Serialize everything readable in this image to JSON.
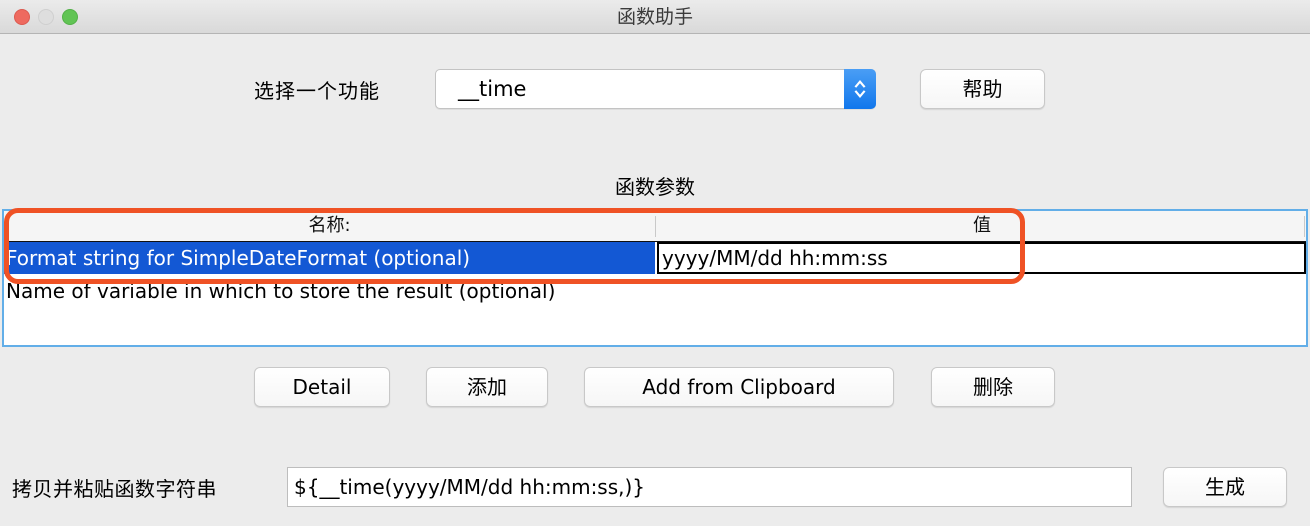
{
  "window": {
    "title": "函数助手",
    "traffic_lights": [
      {
        "name": "close",
        "color": "#ee6a5f"
      },
      {
        "name": "minimize",
        "color": "#dedede"
      },
      {
        "name": "zoom",
        "color": "#61c454"
      }
    ]
  },
  "selector_row": {
    "label": "选择一个功能",
    "combo_value": "__time",
    "combo_stepper_icon": "chevron-up-down-icon",
    "help_label": "帮助"
  },
  "section": {
    "heading": "函数参数"
  },
  "table": {
    "columns": [
      "名称:",
      "值"
    ],
    "rows": [
      {
        "name": "Format string for SimpleDateFormat (optional)",
        "value": "yyyy/MM/dd hh:mm:ss",
        "selected": true,
        "editing": true
      },
      {
        "name": "Name of variable in which to store the result (optional)",
        "value": "",
        "selected": false,
        "editing": false
      }
    ]
  },
  "annotation": {
    "shape": "rounded-rectangle",
    "color": "#ef5225"
  },
  "actions": [
    {
      "label": "Detail"
    },
    {
      "label": "添加"
    },
    {
      "label": "Add from Clipboard"
    },
    {
      "label": "删除"
    }
  ],
  "bottom_row": {
    "label": "拷贝并粘贴函数字符串",
    "field_value": "${__time(yyyy/MM/dd hh:mm:ss,)}",
    "generate_label": "生成"
  },
  "colors": {
    "window_background": "#ececec",
    "selection_blue": "#1358d4",
    "focus_border": "#62aee8",
    "annotation_orange": "#ef5225",
    "stepper_blue": "#1177ec"
  }
}
